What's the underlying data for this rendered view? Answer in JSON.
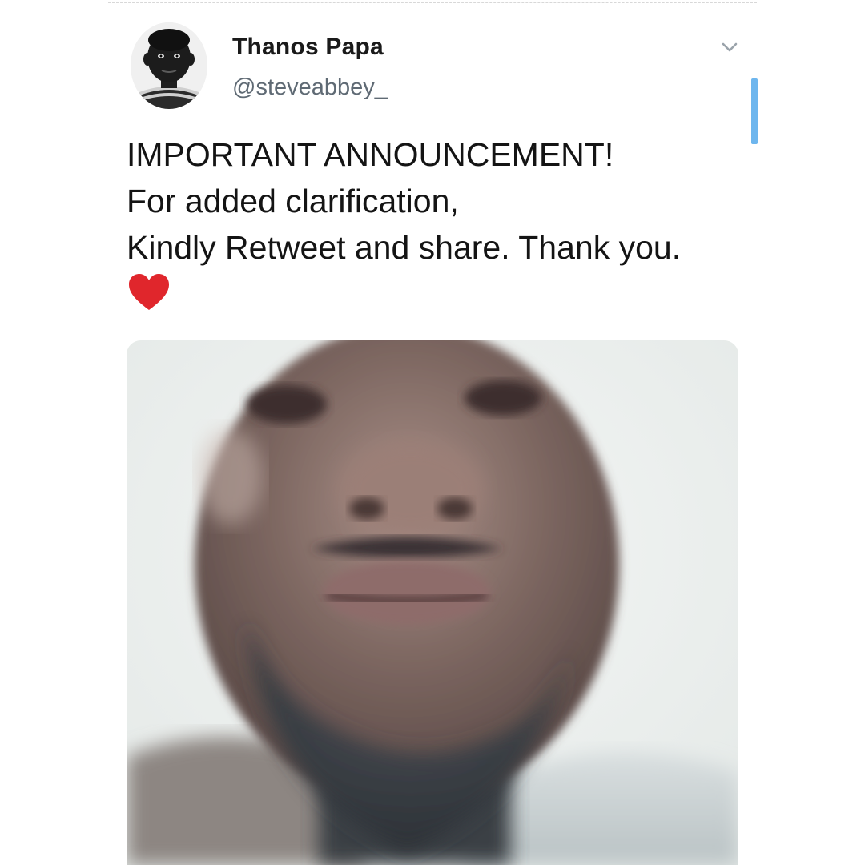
{
  "tweet": {
    "author": {
      "display_name": "Thanos Papa",
      "handle": "@steveabbey_"
    },
    "text_lines": [
      "IMPORTANT ANNOUNCEMENT!",
      "For added clarification,",
      "Kindly Retweet and share. Thank you."
    ],
    "emoji": "heart-emoji",
    "media_type": "video-thumbnail"
  },
  "icons": {
    "menu": "chevron-down-icon",
    "heart": "heart-icon"
  },
  "colors": {
    "heart": "#e0262c",
    "scroll_indicator": "#6eb6ee",
    "handle": "#5f6a74"
  }
}
